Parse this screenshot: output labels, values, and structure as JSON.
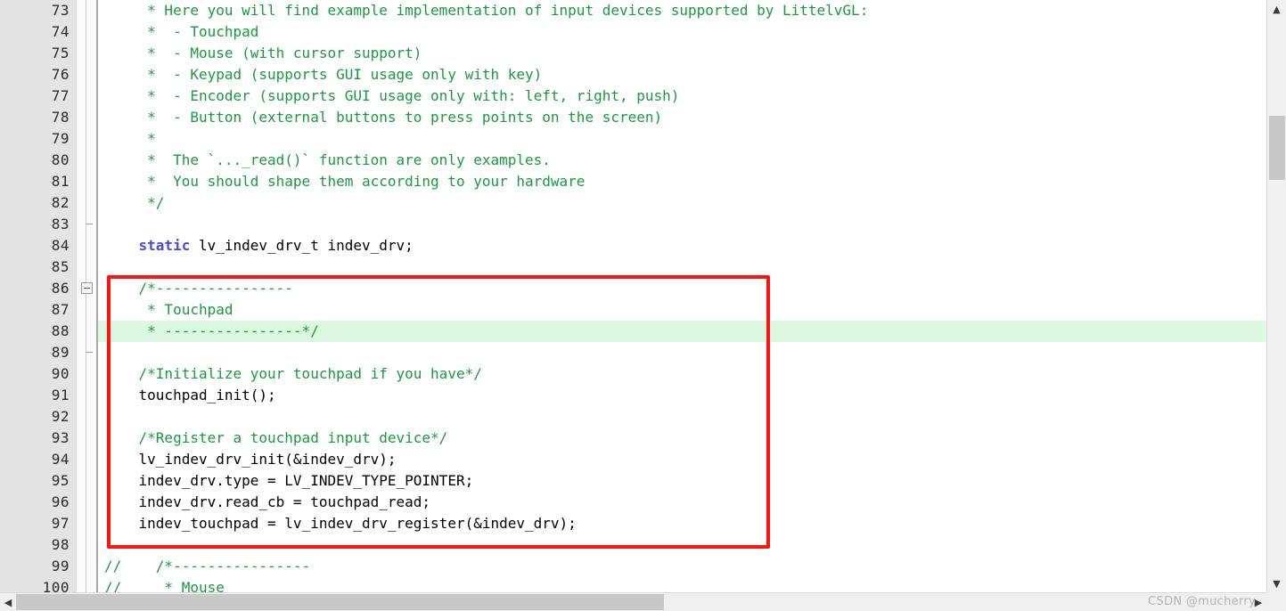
{
  "editor": {
    "first_line": 73,
    "highlighted_line": 88,
    "fold_marker_line": 86,
    "colors": {
      "comment_green": "#1a9a3c",
      "keyword_blue": "#4a4ad8",
      "annotation_red": "#fc1414",
      "current_line_highlight": "#ddf8e0",
      "gutter_background": "#e4e4e4"
    },
    "lines": [
      {
        "num": "73",
        "text": "     * Here you will find example implementation of input devices supported by LittelvGL:",
        "style": "comment"
      },
      {
        "num": "74",
        "text": "     *  - Touchpad",
        "style": "comment"
      },
      {
        "num": "75",
        "text": "     *  - Mouse (with cursor support)",
        "style": "comment"
      },
      {
        "num": "76",
        "text": "     *  - Keypad (supports GUI usage only with key)",
        "style": "comment"
      },
      {
        "num": "77",
        "text": "     *  - Encoder (supports GUI usage only with: left, right, push)",
        "style": "comment"
      },
      {
        "num": "78",
        "text": "     *  - Button (external buttons to press points on the screen)",
        "style": "comment"
      },
      {
        "num": "79",
        "text": "     *",
        "style": "comment"
      },
      {
        "num": "80",
        "text": "     *  The `..._read()` function are only examples.",
        "style": "comment"
      },
      {
        "num": "81",
        "text": "     *  You should shape them according to your hardware",
        "style": "comment"
      },
      {
        "num": "82",
        "text": "     */",
        "style": "comment"
      },
      {
        "num": "83",
        "text": "",
        "style": "plain"
      },
      {
        "num": "84",
        "text": "    static lv_indev_drv_t indev_drv;",
        "style": "keyword-static"
      },
      {
        "num": "85",
        "text": "",
        "style": "plain"
      },
      {
        "num": "86",
        "text": "    /*----------------",
        "style": "comment"
      },
      {
        "num": "87",
        "text": "     * Touchpad",
        "style": "comment"
      },
      {
        "num": "88",
        "text": "     * ----------------*/",
        "style": "comment"
      },
      {
        "num": "89",
        "text": "",
        "style": "plain"
      },
      {
        "num": "90",
        "text": "    /*Initialize your touchpad if you have*/",
        "style": "comment"
      },
      {
        "num": "91",
        "text": "    touchpad_init();",
        "style": "plain"
      },
      {
        "num": "92",
        "text": "",
        "style": "plain"
      },
      {
        "num": "93",
        "text": "    /*Register a touchpad input device*/",
        "style": "comment"
      },
      {
        "num": "94",
        "text": "    lv_indev_drv_init(&indev_drv);",
        "style": "plain"
      },
      {
        "num": "95",
        "text": "    indev_drv.type = LV_INDEV_TYPE_POINTER;",
        "style": "plain"
      },
      {
        "num": "96",
        "text": "    indev_drv.read_cb = touchpad_read;",
        "style": "plain"
      },
      {
        "num": "97",
        "text": "    indev_touchpad = lv_indev_drv_register(&indev_drv);",
        "style": "plain"
      },
      {
        "num": "98",
        "text": "",
        "style": "plain"
      },
      {
        "num": "99",
        "text": "//    /*----------------",
        "style": "comment"
      },
      {
        "num": "100",
        "text": "//     * Mouse",
        "style": "comment"
      }
    ]
  },
  "keywords": {
    "static": "static"
  },
  "scrollbars": {
    "vertical_up_icon": "▲",
    "vertical_down_icon": "▼",
    "horizontal_left_icon": "◀",
    "horizontal_right_icon": "▶"
  },
  "watermark": {
    "text": "CSDN @mucherry"
  }
}
